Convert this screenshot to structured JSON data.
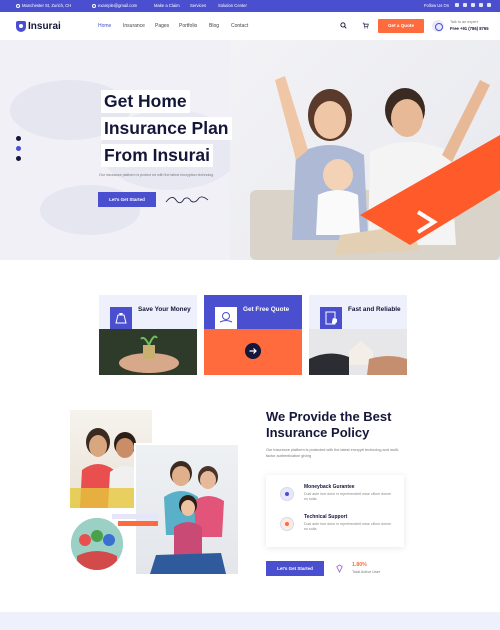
{
  "topbar": {
    "address": "Manchester St, Zurich, CH",
    "email": "example@gmail.com",
    "links": [
      "Make a Claim",
      "Services",
      "Solution Center"
    ],
    "follow": "Follow Us On",
    "socials": [
      "facebook-icon",
      "twitter-icon",
      "instagram-icon",
      "youtube-icon",
      "linkedin-icon"
    ]
  },
  "header": {
    "logo": "Insurai",
    "nav": [
      "Home",
      "Insurance",
      "Pages",
      "Portfolio",
      "Blog",
      "Contact"
    ],
    "active_nav": "Home",
    "quote_button": "Get a Quote",
    "support_label": "Talk to an expert",
    "support_phone": "Free +91 (786) 8765"
  },
  "hero": {
    "title_lines": [
      "Get Home",
      "Insurance Plan",
      "From Insurai"
    ],
    "subtitle": "Our insurance platform is protect ed with the latest encryption technolog",
    "button": "Let's Get Started",
    "slides_count": 3,
    "active_slide": 2
  },
  "features": [
    {
      "title": "Save Your Money",
      "icon": "money-bag-icon"
    },
    {
      "title": "Get Free Quote",
      "icon": "hand-coin-icon",
      "featured": true
    },
    {
      "title": "Fast and Reliable",
      "icon": "document-shield-icon"
    }
  ],
  "policy": {
    "title_lines": [
      "We Provide the Best",
      "Insurance Policy"
    ],
    "description": "Our insurance platform is protected with the latest encrypti technolog and multi-factor authentication giving",
    "benefits": [
      {
        "title": "Moneyback Gurantee",
        "description": "Duis aute irue dolor in reprehenderit esse cillum dolore eu sulla.",
        "icon": "money-back-icon",
        "color": "#4a4fcf"
      },
      {
        "title": "Technical Support",
        "description": "Duis aute irue dolor in reprehenderit esse cillum dolore eu sulla.",
        "icon": "support-gear-icon",
        "color": "#ff6b3d"
      }
    ],
    "button": "Let's Get Started",
    "stat_value": "1.80%",
    "stat_label": "Total Active User"
  },
  "colors": {
    "brand": "#4a4fcf",
    "accent": "#ff6b3d",
    "dark": "#15173a"
  }
}
